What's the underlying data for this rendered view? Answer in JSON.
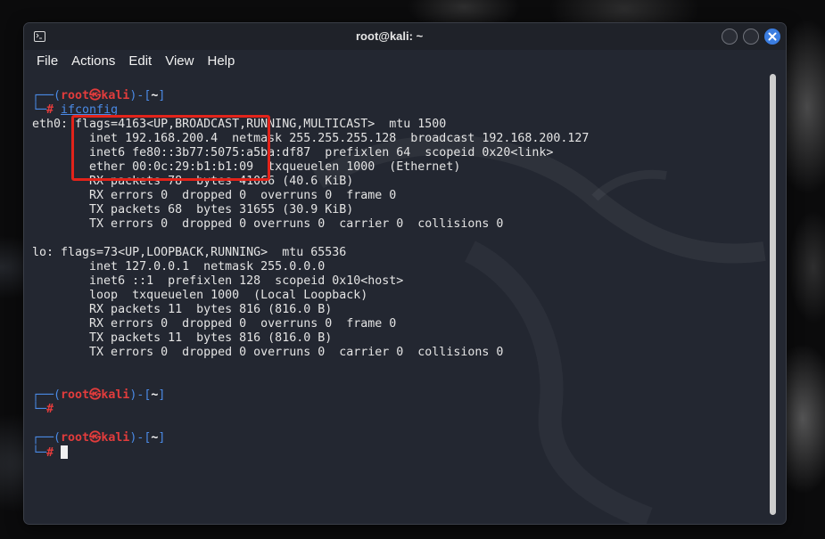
{
  "window": {
    "title": "root@kali: ~"
  },
  "menu": {
    "items": [
      "File",
      "Actions",
      "Edit",
      "View",
      "Help"
    ]
  },
  "prompt": {
    "open": "┌──(",
    "user_host": "root㉿kali",
    "dir_open": ")-[",
    "dir": "~",
    "dir_close": "]",
    "corner": "└─",
    "symbol": "#"
  },
  "commands": [
    "ifconfig"
  ],
  "output": {
    "eth0": [
      "eth0: flags=4163<UP,BROADCAST,RUNNING,MULTICAST>  mtu 1500",
      "        inet 192.168.200.4  netmask 255.255.255.128  broadcast 192.168.200.127",
      "        inet6 fe80::3b77:5075:a5ba:df87  prefixlen 64  scopeid 0x20<link>",
      "        ether 00:0c:29:b1:b1:09  txqueuelen 1000  (Ethernet)",
      "        RX packets 78  bytes 41066 (40.6 KiB)",
      "        RX errors 0  dropped 0  overruns 0  frame 0",
      "        TX packets 68  bytes 31655 (30.9 KiB)",
      "        TX errors 0  dropped 0 overruns 0  carrier 0  collisions 0"
    ],
    "lo": [
      "lo: flags=73<UP,LOOPBACK,RUNNING>  mtu 65536",
      "        inet 127.0.0.1  netmask 255.0.0.0",
      "        inet6 ::1  prefixlen 128  scopeid 0x10<host>",
      "        loop  txqueuelen 1000  (Local Loopback)",
      "        RX packets 11  bytes 816 (816.0 B)",
      "        RX errors 0  dropped 0  overruns 0  frame 0",
      "        TX packets 11  bytes 816 (816.0 B)",
      "        TX errors 0  dropped 0 overruns 0  carrier 0  collisions 0"
    ]
  },
  "colors": {
    "prompt_line": "#4a8ae6",
    "prompt_user": "#e23c3c",
    "highlight_box": "#e2231a",
    "close_button": "#3b7de0"
  }
}
